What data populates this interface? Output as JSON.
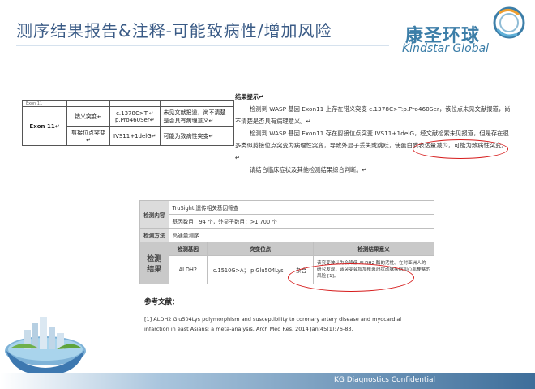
{
  "header": {
    "title": "测序结果报告&注释-可能致病性/增加风险",
    "logo_cn": "康圣环球",
    "logo_en": "Kindstar Global"
  },
  "table1": {
    "cutoff_row": [
      "Exon 11",
      "Text"
    ],
    "rows": [
      {
        "gene": "Exon 11↵",
        "type": "错义突变↵",
        "variant": "c.1378C>T:↵ p.Pro460Ser↵",
        "note": "未见文献报道，尚不清楚是否具有病理意义↵"
      },
      {
        "gene": "",
        "type": "剪接位点突变↵",
        "variant": "IVS11+1delG↵",
        "note": "可能为致病性突变↵"
      }
    ]
  },
  "results": {
    "title": "结果提示↵",
    "para1": "检测到 WASP 基因 Exon11 上存在错义突变 c.1378C>T:p.Pro460Ser，该位点未见文献报道，尚不清楚是否具有病理意义。↵",
    "para2": "检测到 WASP 基因 Exon11 存在剪接位点突变 IVS11+1delG，经文献检索未见报道，但是存在很多类似剪接位点突变为病理性突变，导致外显子丢失或跳跃，使蛋白质表达量减少，可能为致病性突变。↵",
    "para3": "请结合临床症状及其他检测结果综合判断。↵"
  },
  "method_table": {
    "row1_label": "检测内容",
    "row1_value": "TruSight 遗传相关基因筛查",
    "row2_value": "基因数目：94 个，外显子数目：>1,700 个",
    "row3_label": "检测方法",
    "row3_value": "高通量测序",
    "result_label": "检测结果",
    "head_gene": "检测基因",
    "head_site": "突变位点",
    "head_meaning": "检测结果意义",
    "gene": "ALDH2",
    "site": "c.1510G>A； p.Glu504Lys",
    "zygosity": "杂合",
    "meaning": "该突变被认为会降低 ALDH2 酶的活性。在对亚洲人的研究发现，该突变会增加罹患冠状动脉疾病和心肌梗塞的风险 [1]。"
  },
  "references": {
    "title": "参考文献：",
    "text": "[1] ALDH2 Glu504Lys polymorphism and susceptibility to coronary artery disease and myocardial infarction in east Asians: a meta-analysis. Arch Med Res. 2014 Jan;45(1):76-83."
  },
  "footer": {
    "text": "KG Diagnostics Confidential"
  },
  "colors": {
    "title": "#3a5b86",
    "brand": "#3c7ea8",
    "highlight": "#d61b1b",
    "footer": "#3e6e9a"
  }
}
